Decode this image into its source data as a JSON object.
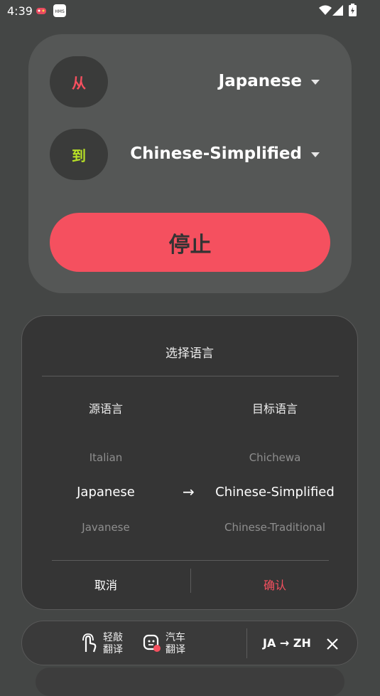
{
  "status_bar": {
    "time": "4:39",
    "notification_icons": [
      "game-icon",
      "hms-icon"
    ],
    "system_icons": [
      "wifi-icon",
      "signal-icon",
      "battery-charging-icon"
    ]
  },
  "translator": {
    "from_label": "从",
    "from_language": "Japanese",
    "to_label": "到",
    "to_language": "Chinese-Simplified",
    "stop_button": "停止"
  },
  "dialog": {
    "title": "选择语言",
    "source_header": "源语言",
    "target_header": "目标语言",
    "source_options": [
      "Italian",
      "Japanese",
      "Javanese"
    ],
    "target_options": [
      "Chichewa",
      "Chinese-Simplified",
      "Chinese-Traditional"
    ],
    "arrow": "→",
    "cancel": "取消",
    "confirm": "确认"
  },
  "bottom_bar": {
    "tap_translate": "轻敲\n翻译",
    "car_translate": "汽车\n翻译",
    "language_pair": "JA → ZH"
  },
  "colors": {
    "accent": "#f5505f",
    "from_label": "#f5505f",
    "to_label": "#b7e026"
  }
}
